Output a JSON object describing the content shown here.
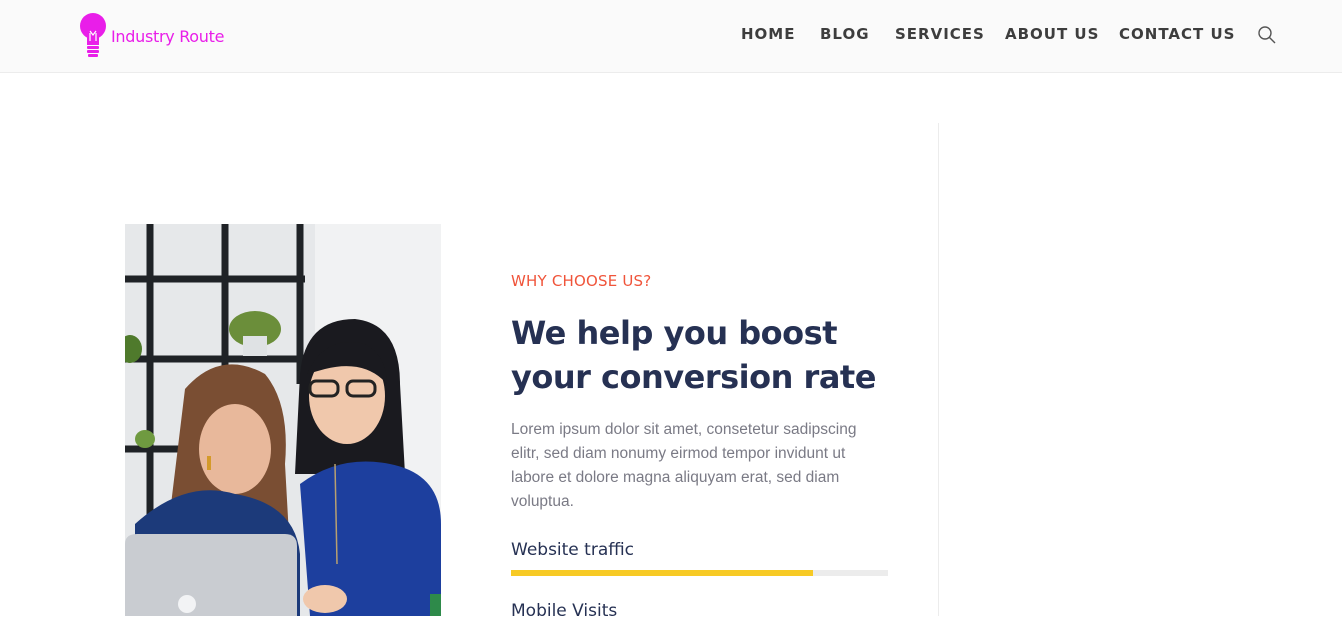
{
  "header": {
    "logo_text": "Industry Route",
    "brand_color": "#e91ee9",
    "nav": [
      {
        "label": "HOME"
      },
      {
        "label": "BLOG"
      },
      {
        "label": "SERVICES"
      },
      {
        "label": "ABOUT US"
      },
      {
        "label": "CONTACT US"
      }
    ],
    "search_icon": "search-icon"
  },
  "main": {
    "eyebrow": "WHY CHOOSE US?",
    "headline": "We help you boost your conversion rate",
    "body": "Lorem ipsum dolor sit amet, consetetur sadipscing elitr, sed diam nonumy eirmod tempor invidunt ut labore et dolore magna aliquyam erat, sed diam voluptua.",
    "skills": [
      {
        "label": "Website traffic",
        "percent": 80
      },
      {
        "label": "Mobile Visits"
      }
    ],
    "accent_color": "#f0543a",
    "bar_color": "#f7ca25"
  }
}
